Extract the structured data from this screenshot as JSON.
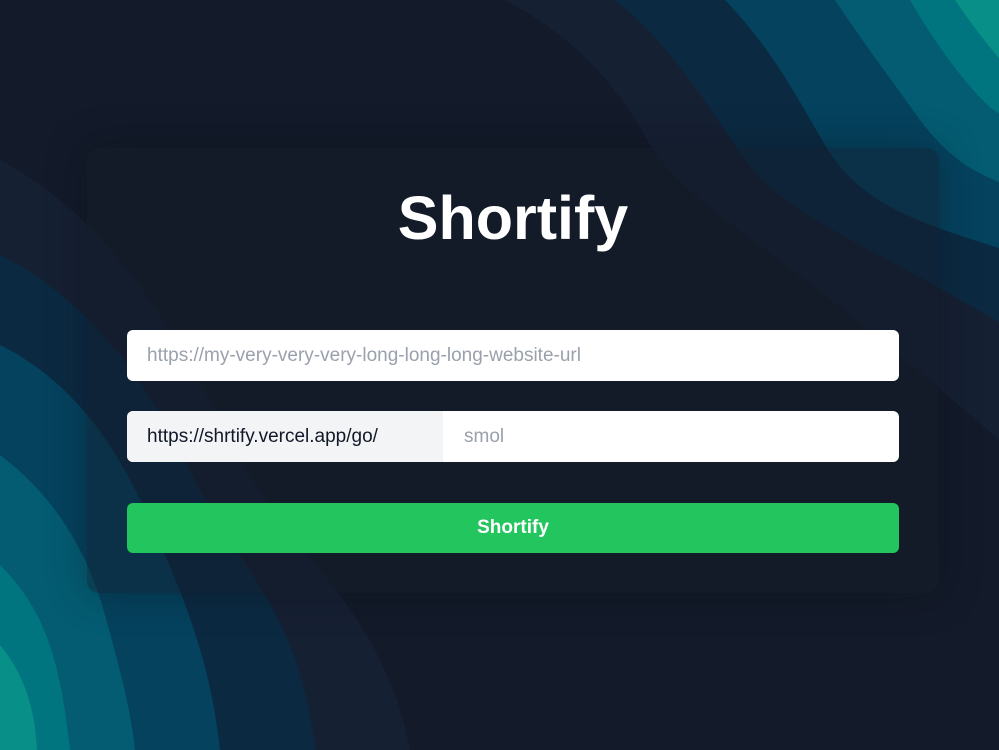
{
  "app": {
    "title": "Shortify"
  },
  "form": {
    "long_url": {
      "value": "",
      "placeholder": "https://my-very-very-very-long-long-long-website-url"
    },
    "short_url": {
      "prefix": "https://shrtify.vercel.app/go/",
      "value": "",
      "placeholder": "smol"
    },
    "submit_label": "Shortify"
  },
  "theme": {
    "background": "#131a29",
    "wave_dark": "#162033",
    "wave_navy": "#0b2a42",
    "wave_blue": "#05425e",
    "wave_teal": "#045c72",
    "wave_cyan": "#00757f",
    "wave_green": "#078f88",
    "button": "#22c55e",
    "input_prefix_bg": "#f3f4f6"
  },
  "icons": {
    "background": "wave-pattern-icon"
  }
}
